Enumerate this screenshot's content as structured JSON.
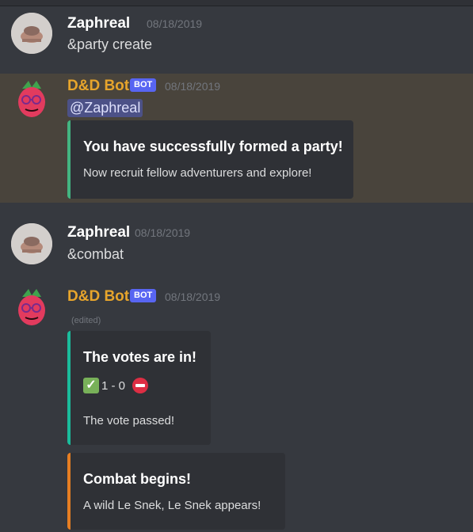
{
  "messages": [
    {
      "author": "Zaphreal",
      "timestamp": "08/18/2019",
      "text": "&party create"
    },
    {
      "author": "D&D Bot",
      "badge": "BOT",
      "timestamp": "08/18/2019",
      "mention": "@Zaphreal",
      "embed": {
        "title": "You have successfully formed a party!",
        "description": "Now recruit fellow adventurers and explore!",
        "color": "#43b581"
      }
    },
    {
      "author": "Zaphreal",
      "timestamp": "08/18/2019",
      "text": "&combat"
    },
    {
      "author": "D&D Bot",
      "badge": "BOT",
      "timestamp": "08/18/2019",
      "edited": "(edited)",
      "embeds": [
        {
          "title": "The votes are in!",
          "vote_check": "✓",
          "vote_result": "1 - 0",
          "description": "The vote passed!",
          "color": "#1abc9c"
        },
        {
          "title": "Combat begins!",
          "description": "A wild Le Snek, Le Snek appears!",
          "color": "#e67e22"
        }
      ]
    }
  ],
  "colors": {
    "background": "#36393f",
    "mention_highlight": "#49443c",
    "bot_name": "#e7a52c",
    "badge": "#5865f2"
  },
  "icons": {
    "vote_yes": "check-mark-emoji",
    "vote_no": "no-entry-emoji"
  }
}
